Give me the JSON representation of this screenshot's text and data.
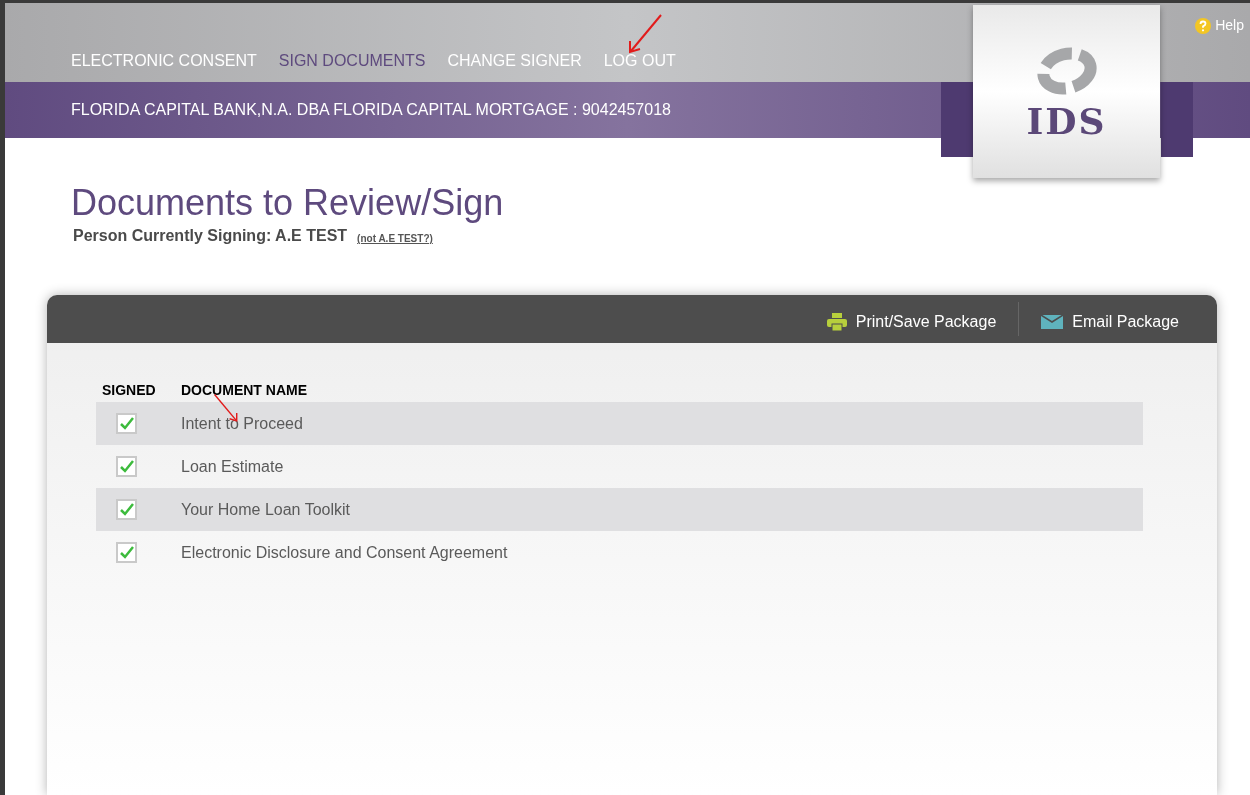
{
  "nav": [
    {
      "label": "ELECTRONIC CONSENT",
      "selected": false
    },
    {
      "label": "SIGN DOCUMENTS",
      "selected": true
    },
    {
      "label": "CHANGE SIGNER",
      "selected": false
    },
    {
      "label": "LOG OUT",
      "selected": false
    }
  ],
  "help": "Help",
  "logo": {
    "text": "IDS"
  },
  "lender": "FLORIDA CAPITAL BANK,N.A. DBA FLORIDA CAPITAL MORTGAGE : 9042457018",
  "page_title": "Documents to Review/Sign",
  "signer": {
    "label": "Person Currently Signing: A.E TEST",
    "link": "(not A.E TEST?)"
  },
  "toolbar": [
    {
      "kind": "print",
      "label": "Print/Save Package"
    },
    {
      "kind": "email",
      "label": "Email Package"
    }
  ],
  "table": {
    "columns": [
      "SIGNED",
      "DOCUMENT NAME"
    ],
    "rows": [
      {
        "signed": true,
        "name": "Intent to Proceed"
      },
      {
        "signed": true,
        "name": "Loan Estimate"
      },
      {
        "signed": true,
        "name": "Your Home Loan Toolkit"
      },
      {
        "signed": true,
        "name": "Electronic Disclosure and Consent Agreement"
      }
    ]
  }
}
